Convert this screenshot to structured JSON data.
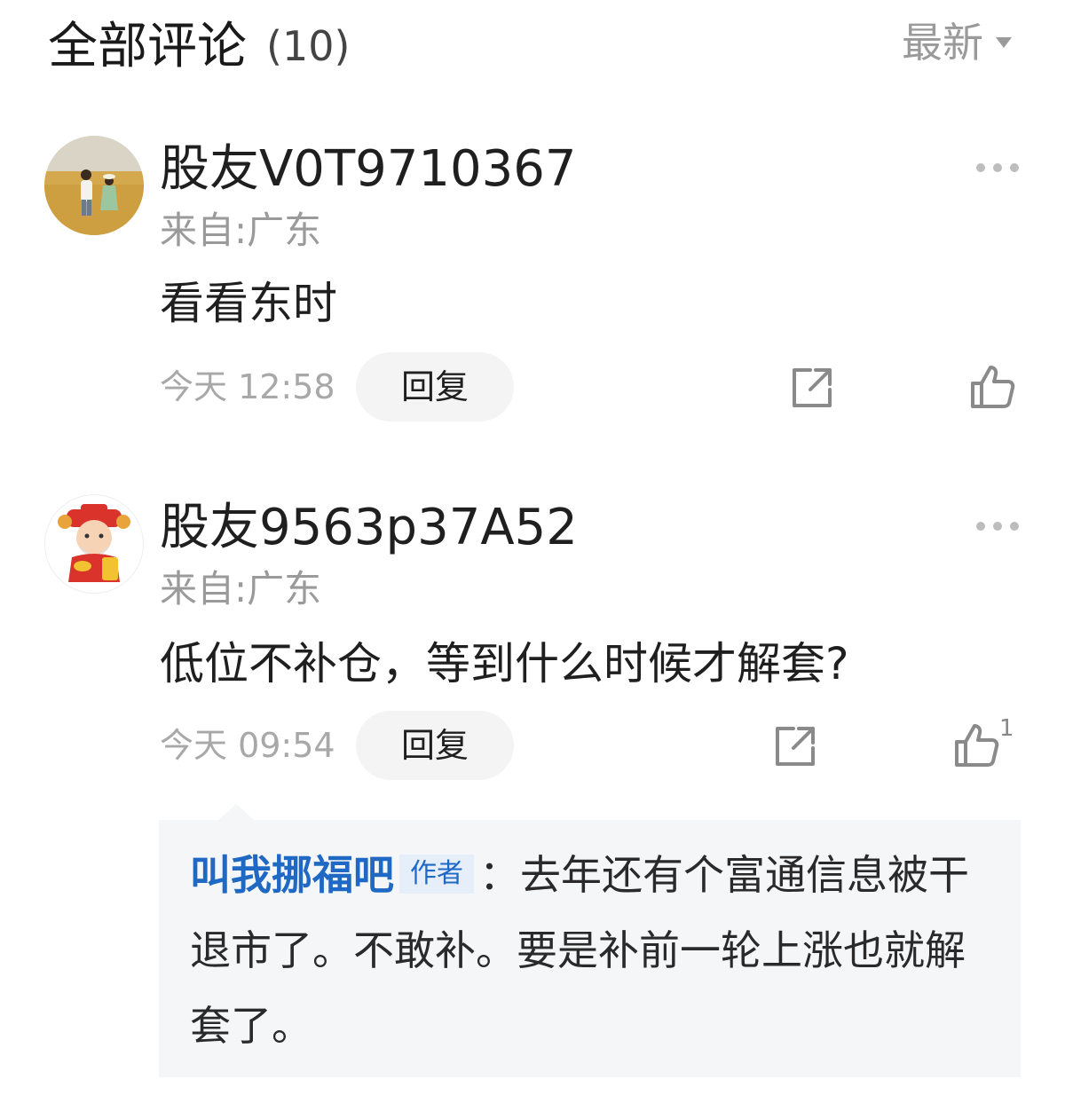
{
  "header": {
    "title": "全部评论",
    "count": "(10)",
    "sort_label": "最新"
  },
  "comments": [
    {
      "username": "股友V0T9710367",
      "location": "来自:广东",
      "content": "看看东时",
      "time": "今天 12:58",
      "reply_label": "回复",
      "like_count": ""
    },
    {
      "username": "股友9563p37A52",
      "location": "来自:广东",
      "content": "低位不补仓，等到什么时候才解套?",
      "time": "今天 09:54",
      "reply_label": "回复",
      "like_count": "1",
      "reply": {
        "author": "叫我挪福吧",
        "badge": "作者",
        "separator": "：",
        "text": "去年还有个富通信息被干退市了。不敢补。要是补前一轮上涨也就解套了。"
      }
    }
  ],
  "icons": {
    "more": "more-icon",
    "share": "share-icon",
    "like": "thumbs-up-icon",
    "sort": "caret-down-icon"
  }
}
